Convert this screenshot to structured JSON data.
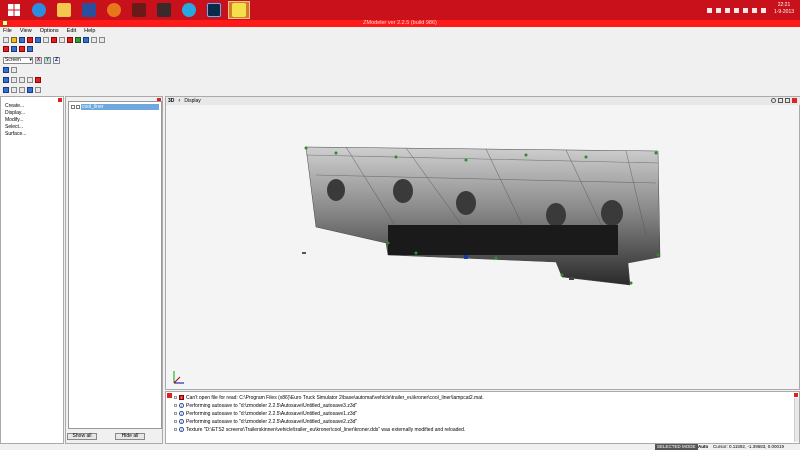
{
  "taskbar": {
    "icons": [
      "windows-start-icon",
      "internet-explorer-icon",
      "file-explorer-icon",
      "save-app-icon",
      "firefox-icon",
      "ets2-icon",
      "game-icon",
      "skype-icon",
      "photoshop-icon",
      "zmodeler-icon"
    ],
    "clock_time": "22:21",
    "clock_date": "1-9-2013"
  },
  "window": {
    "title": "ZModeler ver 2.2.5 (build 986)"
  },
  "menu": [
    "File",
    "View",
    "Options",
    "Edit",
    "Help"
  ],
  "toolbar": {
    "view_select": "Screen",
    "axis_x": "X",
    "axis_y": "Y",
    "axis_z": "Z"
  },
  "left_panel": {
    "items": [
      "Create...",
      "Display...",
      "Modify...",
      "Select...",
      "Surface..."
    ]
  },
  "tree_panel": {
    "node_label": "cool_liner",
    "show_all": "Show all",
    "hide_all": "Hide all"
  },
  "viewport": {
    "mode_label": "3D",
    "tab_label": "Display"
  },
  "console": {
    "lines": [
      {
        "type": "error",
        "text": "Can't open file for read: C:\\Program Files (x86)\\Euro Truck Simulator 2\\base\\automat\\vehicle\\trailer_eu\\kroner\\cool_liner\\lampcat2.mat."
      },
      {
        "type": "info",
        "text": "Performing autosave to \"d:\\zmodeler 2.2.5\\Autosave\\Untitled_autosave3.z3d\""
      },
      {
        "type": "info",
        "text": "Performing autosave to \"d:\\zmodeler 2.2.5\\Autosave\\Untitled_autosave1.z3d\""
      },
      {
        "type": "info",
        "text": "Performing autosave to \"d:\\zmodeler 2.2.5\\Autosave\\Untitled_autosave2.z3d\""
      },
      {
        "type": "info",
        "text": "Texture \"D:\\ETS2 screens\\Trailerskinnen\\vehicle\\trailer_eu\\kroner\\cool_liner\\kroner.dds\" was externally modified and reloaded."
      }
    ]
  },
  "status": {
    "mode": "SELECTED MODE",
    "auto": "Auto",
    "cursor": "Cursor: 0.11592, -1.39683, 0.00019"
  }
}
